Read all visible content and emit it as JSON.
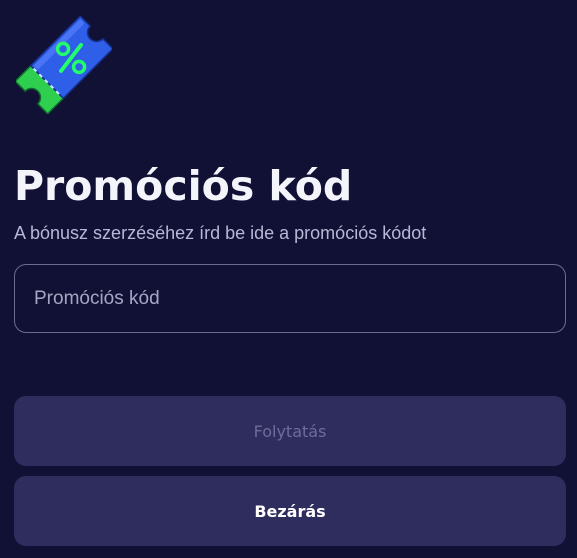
{
  "header": {
    "icon": "percent-ticket-icon",
    "title": "Promóciós kód",
    "subtitle": "A bónusz szerzéséhez írd be ide a promóciós kódot"
  },
  "promo_input": {
    "value": "",
    "placeholder": "Promóciós kód"
  },
  "actions": {
    "continue_label": "Folytatás",
    "close_label": "Bezárás"
  },
  "colors": {
    "background": "#111135",
    "button_bg": "#2f2d5e",
    "disabled_text": "#6e6c98",
    "ticket_blue": "#2f5ee8",
    "ticket_green": "#2ecf4f",
    "percent_green": "#23ff6a"
  }
}
